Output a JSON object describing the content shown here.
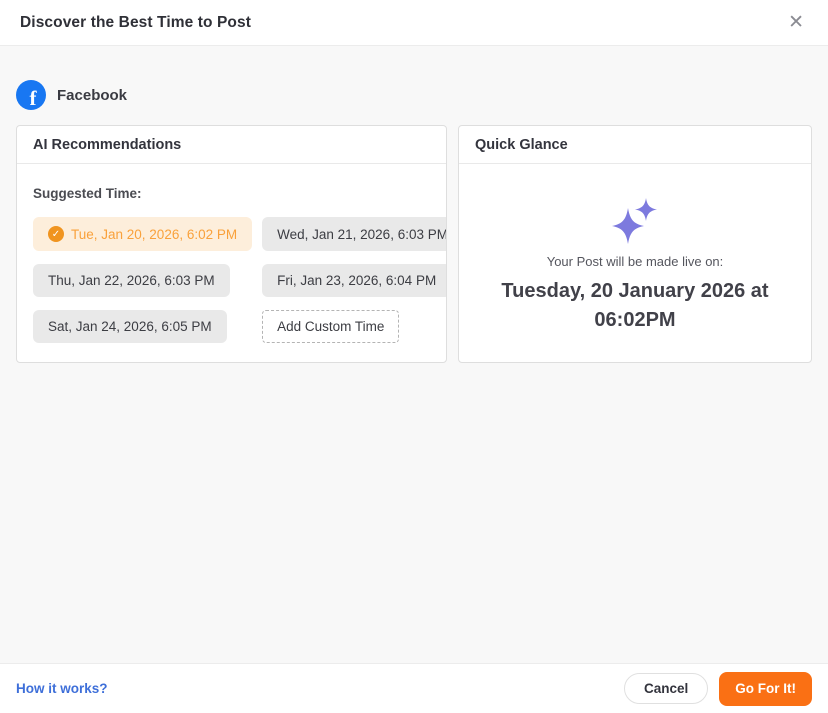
{
  "modal": {
    "title": "Discover the Best Time to Post",
    "close_icon": "✕"
  },
  "platform": {
    "name": "Facebook",
    "logo_letter": "f"
  },
  "ai_recommendations": {
    "heading": "AI Recommendations",
    "suggested_time_label": "Suggested Time:",
    "suggestions": [
      {
        "label": "Tue, Jan 20, 2026, 6:02 PM",
        "selected": true
      },
      {
        "label": "Wed, Jan 21, 2026, 6:03 PM",
        "selected": false
      },
      {
        "label": "Thu, Jan 22, 2026, 6:03 PM",
        "selected": false
      },
      {
        "label": "Fri, Jan 23, 2026, 6:04 PM",
        "selected": false
      },
      {
        "label": "Sat, Jan 24, 2026, 6:05 PM",
        "selected": false
      }
    ],
    "check_icon": "✓",
    "add_custom_time_label": "Add Custom Time"
  },
  "quick_glance": {
    "heading": "Quick Glance",
    "sparkles_icon": "sparkles-icon",
    "live_caption": "Your Post will be made live on:",
    "live_datetime": "Tuesday, 20 January 2026 at 06:02PM"
  },
  "footer": {
    "help_link_label": "How it works?",
    "cancel_label": "Cancel",
    "confirm_label": "Go For It!"
  },
  "colors": {
    "accent_orange": "#fa7014",
    "selected_chip_bg": "#fdeedb",
    "selected_chip_text": "#f9a13b",
    "check_badge_orange": "#f0941f",
    "facebook_blue": "#1877f2",
    "sparkle_purple": "#7d7ade",
    "link_blue": "#3e6fd9",
    "body_bg": "#f8f8f8"
  }
}
